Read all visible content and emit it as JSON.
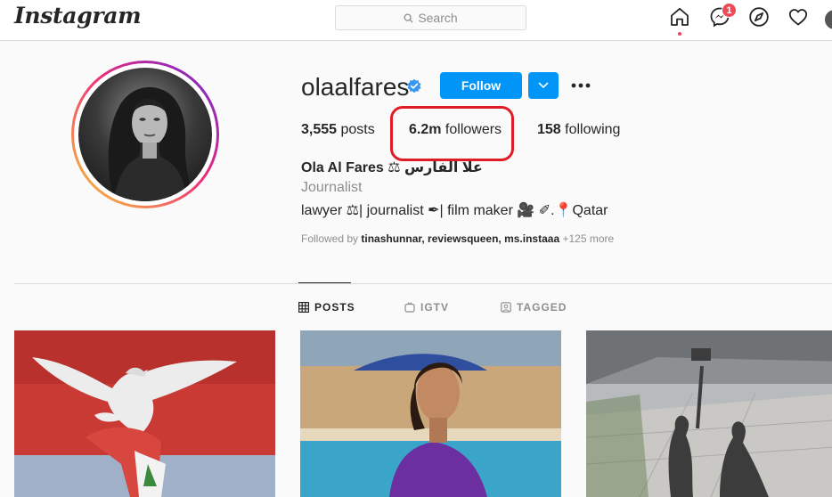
{
  "nav": {
    "logo": "Instagram",
    "search_placeholder": "Search",
    "messages_badge": "1",
    "icons": [
      "home-icon",
      "messenger-icon",
      "explore-icon",
      "heart-icon",
      "avatar"
    ]
  },
  "profile": {
    "username": "olaalfares",
    "verified": true,
    "follow_label": "Follow",
    "stats": {
      "posts_count": "3,555",
      "posts_label": "posts",
      "followers_count": "6.2m",
      "followers_label": "followers",
      "following_count": "158",
      "following_label": "following"
    },
    "full_name": "Ola Al Fares ⚖ علا الفارس",
    "category": "Journalist",
    "bio": "lawyer ⚖| journalist ✒| film maker 🎥 ✐.📍Qatar",
    "followed_by_prefix": "Followed by",
    "followed_by_names": "tinashunnar, reviewsqueen, ms.instaaa",
    "followed_by_more": "+125 more"
  },
  "tabs": [
    {
      "label": "POSTS",
      "icon": "grid-icon",
      "active": true
    },
    {
      "label": "IGTV",
      "icon": "igtv-icon",
      "active": false
    },
    {
      "label": "TAGGED",
      "icon": "tagged-icon",
      "active": false
    }
  ],
  "colors": {
    "accent": "#0095f6",
    "badge": "#ed4956",
    "highlight_annotation": "#e01b24"
  }
}
